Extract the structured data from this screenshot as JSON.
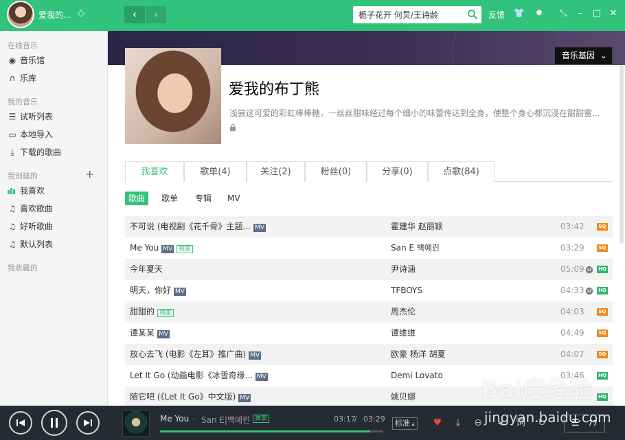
{
  "colors": {
    "accent": "#31c27c",
    "topbar": "#31c27c",
    "player_bg": "#262a31",
    "sq": "#f08a1c",
    "hq": "#2fb36a"
  },
  "topbar": {
    "username": "爱我的...",
    "search_value": "栀子花开 何炅/王诗龄",
    "feedback_label": "反馈",
    "icons": [
      "vip-icon",
      "back-icon",
      "forward-icon",
      "search-icon",
      "skin-icon",
      "settings-icon",
      "mini-mode-icon",
      "minimize-icon",
      "maximize-icon",
      "close-icon"
    ]
  },
  "sidebar": {
    "online_title": "在线音乐",
    "online_items": [
      {
        "label": "音乐馆",
        "icon": "disc-icon"
      },
      {
        "label": "乐库",
        "icon": "headphones-icon"
      }
    ],
    "mine_title": "我的音乐",
    "mine_items": [
      {
        "label": "试听列表",
        "icon": "list-icon"
      },
      {
        "label": "本地导入",
        "icon": "monitor-icon"
      },
      {
        "label": "下载的歌曲",
        "icon": "download-icon"
      }
    ],
    "created_title": "我创建的",
    "created_items": [
      {
        "label": "我喜欢",
        "icon": "equalizer-icon"
      },
      {
        "label": "喜欢歌曲",
        "icon": "music-note-icon"
      },
      {
        "label": "好听歌曲",
        "icon": "music-note-icon"
      },
      {
        "label": "默认列表",
        "icon": "music-note-icon"
      }
    ],
    "collected_title": "我收藏的"
  },
  "profile": {
    "gene_button": "音乐基因",
    "name": "爱我的布丁熊",
    "description": "浅尝这可爱的彩虹棒棒糖，一丝丝甜味经过每个细小的味蕾传达到全身，使整个身心都沉浸在甜甜蜜..."
  },
  "tabs": [
    "我喜欢",
    "歌单(4)",
    "关注(2)",
    "粉丝(0)",
    "分享(0)",
    "点歌(84)"
  ],
  "subtabs": [
    "歌曲",
    "歌单",
    "专辑",
    "MV"
  ],
  "songs": [
    {
      "title": "不可说 (电视剧《花千骨》主题...",
      "badges": [
        "MV"
      ],
      "singer": "霍建华 赵丽颖",
      "time": "03:42",
      "globe": false,
      "quality": "SQ"
    },
    {
      "title": "Me You",
      "badges": [
        "MV",
        "独家"
      ],
      "singer": "San E 백예린",
      "time": "03:29",
      "globe": false,
      "quality": "SQ"
    },
    {
      "title": "今年夏天",
      "badges": [],
      "singer": "尹诗涵",
      "time": "05:09",
      "globe": true,
      "quality": "HQ"
    },
    {
      "title": "明天，你好",
      "badges": [
        "MV"
      ],
      "singer": "TFBOYS",
      "time": "04:33",
      "globe": true,
      "quality": "HQ"
    },
    {
      "title": "甜甜的",
      "badges": [
        "独家"
      ],
      "singer": "周杰伦",
      "time": "04:03",
      "globe": false,
      "quality": "SQ"
    },
    {
      "title": "谭某某",
      "badges": [
        "MV"
      ],
      "singer": "谭维维",
      "time": "04:49",
      "globe": false,
      "quality": "SQ"
    },
    {
      "title": "放心去飞 (电影《左耳》推广曲)",
      "badges": [
        "MV"
      ],
      "singer": "欧豪 杨洋 胡夏",
      "time": "04:07",
      "globe": false,
      "quality": "SQ"
    },
    {
      "title": "Let It Go (动画电影《冰雪奇缘...",
      "badges": [
        "MV"
      ],
      "singer": "Demi Lovato",
      "time": "03:46",
      "globe": false,
      "quality": "HQ"
    },
    {
      "title": "随它吧 (《Let It Go》中文版)",
      "badges": [
        "MV"
      ],
      "singer": "姚贝娜",
      "time": "",
      "globe": false,
      "quality": "HQ"
    }
  ],
  "player": {
    "title": "Me You",
    "separator": "-",
    "artist": "San E|백예린",
    "exclusive": "独家",
    "current_time": "03:17",
    "time_sep": "/",
    "total_time": "03:29",
    "progress": 0.94,
    "quality": "标准",
    "playlist_count": "77"
  },
  "watermark": {
    "line1": "Bai度经验",
    "line2": "jingyan.baidu.com"
  }
}
